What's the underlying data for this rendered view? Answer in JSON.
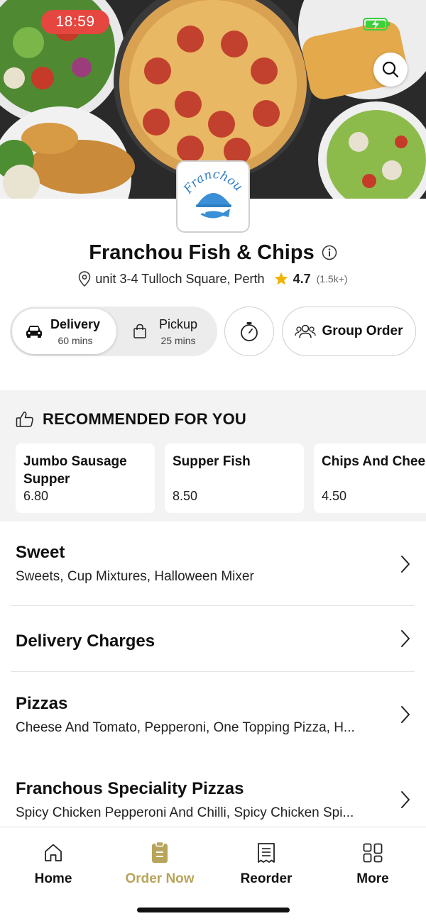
{
  "status_bar": {
    "time": "18:59"
  },
  "restaurant": {
    "logo_text": "Franchou",
    "name": "Franchou Fish & Chips",
    "address": "unit 3-4 Tulloch Square, Perth",
    "rating": "4.7",
    "reviews": "(1.5k+)"
  },
  "modes": {
    "delivery": {
      "label": "Delivery",
      "time": "60 mins",
      "selected": true
    },
    "pickup": {
      "label": "Pickup",
      "time": "25 mins",
      "selected": false
    },
    "group_order_label": "Group Order"
  },
  "recommended": {
    "title": "RECOMMENDED FOR YOU",
    "items": [
      {
        "name": "Jumbo Sausage Supper",
        "price": "6.80"
      },
      {
        "name": "Supper Fish",
        "price": "8.50"
      },
      {
        "name": "Chips And Chee",
        "price": "4.50"
      }
    ]
  },
  "categories": [
    {
      "name": "Sweet",
      "description": "Sweets, Cup Mixtures, Halloween Mixer"
    },
    {
      "name": "Delivery Charges",
      "description": ""
    },
    {
      "name": "Pizzas",
      "description": "Cheese And Tomato, Pepperoni, One Topping Pizza, H..."
    },
    {
      "name": "Franchous Speciality Pizzas",
      "description": "Spicy Chicken Pepperoni And Chilli, Spicy Chicken Spi..."
    }
  ],
  "tabs": [
    {
      "label": "Home",
      "icon": "home-icon"
    },
    {
      "label": "Order Now",
      "icon": "order-icon",
      "active": true
    },
    {
      "label": "Reorder",
      "icon": "receipt-icon"
    },
    {
      "label": "More",
      "icon": "grid-icon"
    }
  ],
  "colors": {
    "accent": "#b8a45a",
    "time_pill": "#e5463f",
    "star": "#f2b200",
    "battery": "#3bd13b"
  }
}
